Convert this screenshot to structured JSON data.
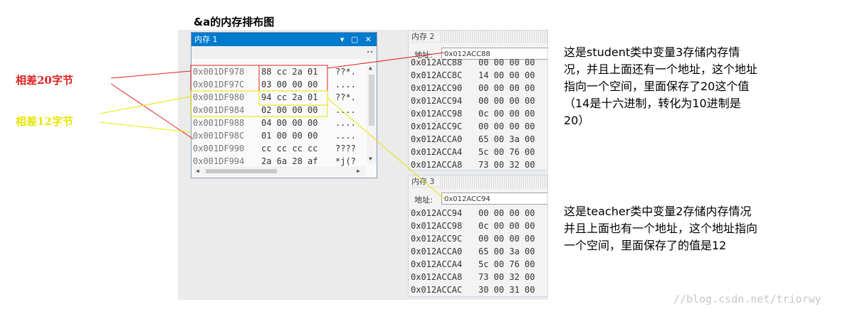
{
  "heading": "&a的内存排布图",
  "window1": {
    "title": "内存 1",
    "controls": "▾ ▢ ✕",
    "rows": [
      {
        "addr": "0x001DF978",
        "bytes": "88 cc 2a 01",
        "ascii": "??*."
      },
      {
        "addr": "0x001DF97C",
        "bytes": "03 00 00 00",
        "ascii": "...."
      },
      {
        "addr": "0x001DF980",
        "bytes": "94 cc 2a 01",
        "ascii": "??*."
      },
      {
        "addr": "0x001DF984",
        "bytes": "02 00 00 00",
        "ascii": "...."
      },
      {
        "addr": "0x001DF988",
        "bytes": "04 00 00 00",
        "ascii": "...."
      },
      {
        "addr": "0x001DF98C",
        "bytes": "01 00 00 00",
        "ascii": "...."
      },
      {
        "addr": "0x001DF990",
        "bytes": "cc cc cc cc",
        "ascii": "????"
      },
      {
        "addr": "0x001DF994",
        "bytes": "2a 6a 28 af",
        "ascii": "*j(?"
      }
    ]
  },
  "window2": {
    "title": "内存 2",
    "address_label": "地址:",
    "address_value": "0x012ACC88",
    "rows": [
      {
        "addr": "0x012ACC88",
        "bytes": "00 00 00 00"
      },
      {
        "addr": "0x012ACC8C",
        "bytes": "14 00 00 00"
      },
      {
        "addr": "0x012ACC90",
        "bytes": "00 00 00 00"
      },
      {
        "addr": "0x012ACC94",
        "bytes": "00 00 00 00"
      },
      {
        "addr": "0x012ACC98",
        "bytes": "0c 00 00 00"
      },
      {
        "addr": "0x012ACC9C",
        "bytes": "00 00 00 00"
      },
      {
        "addr": "0x012ACCA0",
        "bytes": "65 00 3a 00"
      },
      {
        "addr": "0x012ACCA4",
        "bytes": "5c 00 76 00"
      },
      {
        "addr": "0x012ACCA8",
        "bytes": "73 00 32 00"
      }
    ]
  },
  "window3": {
    "title": "内存 3",
    "address_label": "地址:",
    "address_value": "0x012ACC94",
    "rows": [
      {
        "addr": "0x012ACC94",
        "bytes": "00 00 00 00"
      },
      {
        "addr": "0x012ACC98",
        "bytes": "0c 00 00 00"
      },
      {
        "addr": "0x012ACC9C",
        "bytes": "00 00 00 00"
      },
      {
        "addr": "0x012ACCA0",
        "bytes": "65 00 3a 00"
      },
      {
        "addr": "0x012ACCA4",
        "bytes": "5c 00 76 00"
      },
      {
        "addr": "0x012ACCA8",
        "bytes": "73 00 32 00"
      },
      {
        "addr": "0x012ACCAC",
        "bytes": "30 00 31 00"
      }
    ]
  },
  "annotations": {
    "diff20": "相差20字节",
    "diff12": "相差12字节",
    "note_student": "这是student类中变量3存储内存情\n况，并且上面还有一个地址，这个地址\n指向一个空间，里面保存了20这个值\n（14是十六进制，转化为10进制是\n20）",
    "note_teacher": "这是teacher类中变量2存储内存情况\n并且上面也有一个地址，这个地址指向\n一个空间，里面保存了的值是12",
    "watermark": "//blog.csdn.net/triorwy"
  },
  "colors": {
    "title_bar": "#007acc",
    "red_highlight": "#e02020",
    "yellow_highlight": "#e6e600"
  }
}
